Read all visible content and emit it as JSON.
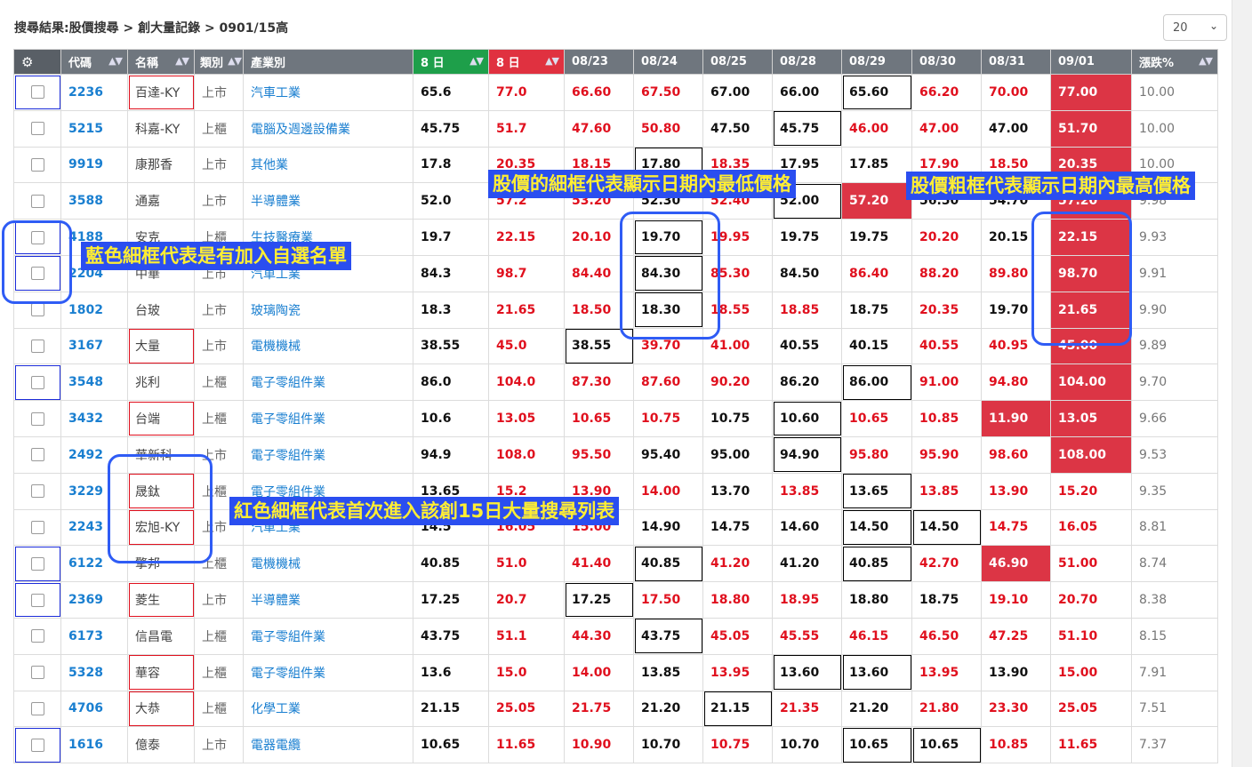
{
  "breadcrumb": "搜尋結果:股價搜尋 > 創大量記錄 > 0901/15高",
  "page_size": {
    "value": "20",
    "chevron_icon": "chevron-down-icon"
  },
  "columns": {
    "settings_icon": "gear-icon",
    "code": "代碼",
    "name": "名稱",
    "type": "類別",
    "industry": "產業別",
    "d8a": "8 日",
    "d8b": "8 日",
    "dates": [
      "08/23",
      "08/24",
      "08/25",
      "08/28",
      "08/29",
      "08/30",
      "08/31",
      "09/01"
    ],
    "pct": "漲跌%"
  },
  "colors": {
    "header": "#6f767e",
    "green_header": "#1e9f4a",
    "red_header": "#e03140",
    "highlight": "#dc3545",
    "link": "#1a7fd0",
    "callout_bg": "#2a4ef0",
    "callout_text": "#ffee33"
  },
  "rows": [
    {
      "code": "2236",
      "name": "百達-KY",
      "type": "上市",
      "industry": "汽車工業",
      "v1": "65.6",
      "v2": "77.0",
      "d": [
        "66.60",
        "67.50",
        "67.00",
        "66.00",
        "65.60",
        "66.20",
        "70.00",
        "77.00"
      ],
      "pct": "10.00"
    },
    {
      "code": "5215",
      "name": "科嘉-KY",
      "type": "上櫃",
      "industry": "電腦及週邊設備業",
      "v1": "45.75",
      "v2": "51.7",
      "d": [
        "47.60",
        "50.80",
        "47.50",
        "45.75",
        "46.00",
        "47.00",
        "47.00",
        "51.70"
      ],
      "pct": "10.00"
    },
    {
      "code": "9919",
      "name": "康那香",
      "type": "上市",
      "industry": "其他業",
      "v1": "17.8",
      "v2": "20.35",
      "d": [
        "18.15",
        "17.80",
        "18.35",
        "17.95",
        "17.85",
        "17.90",
        "18.50",
        "20.35"
      ],
      "pct": "10.00"
    },
    {
      "code": "3588",
      "name": "通嘉",
      "type": "上市",
      "industry": "半導體業",
      "v1": "52.0",
      "v2": "57.2",
      "d": [
        "53.20",
        "52.30",
        "52.40",
        "52.00",
        "57.20",
        "56.50",
        "54.70",
        "57.20"
      ],
      "pct": "9.98"
    },
    {
      "code": "4188",
      "name": "安克",
      "type": "上櫃",
      "industry": "生技醫療業",
      "v1": "19.7",
      "v2": "22.15",
      "d": [
        "20.10",
        "19.70",
        "19.95",
        "19.75",
        "19.75",
        "20.20",
        "20.15",
        "22.15"
      ],
      "pct": "9.93"
    },
    {
      "code": "2204",
      "name": "中華",
      "type": "上市",
      "industry": "汽車工業",
      "v1": "84.3",
      "v2": "98.7",
      "d": [
        "84.40",
        "84.30",
        "85.30",
        "84.50",
        "86.40",
        "88.20",
        "89.80",
        "98.70"
      ],
      "pct": "9.91"
    },
    {
      "code": "1802",
      "name": "台玻",
      "type": "上市",
      "industry": "玻璃陶瓷",
      "v1": "18.3",
      "v2": "21.65",
      "d": [
        "18.50",
        "18.30",
        "18.55",
        "18.85",
        "18.75",
        "20.35",
        "19.70",
        "21.65"
      ],
      "pct": "9.90"
    },
    {
      "code": "3167",
      "name": "大量",
      "type": "上市",
      "industry": "電機機械",
      "v1": "38.55",
      "v2": "45.0",
      "d": [
        "38.55",
        "39.70",
        "41.00",
        "40.55",
        "40.15",
        "40.55",
        "40.95",
        "45.00"
      ],
      "pct": "9.89"
    },
    {
      "code": "3548",
      "name": "兆利",
      "type": "上櫃",
      "industry": "電子零組件業",
      "v1": "86.0",
      "v2": "104.0",
      "d": [
        "87.30",
        "87.60",
        "90.20",
        "86.20",
        "86.00",
        "91.00",
        "94.80",
        "104.00"
      ],
      "pct": "9.70"
    },
    {
      "code": "3432",
      "name": "台端",
      "type": "上櫃",
      "industry": "電子零組件業",
      "v1": "10.6",
      "v2": "13.05",
      "d": [
        "10.65",
        "10.75",
        "10.75",
        "10.60",
        "10.65",
        "10.85",
        "11.90",
        "13.05"
      ],
      "pct": "9.66"
    },
    {
      "code": "2492",
      "name": "華新科",
      "type": "上市",
      "industry": "電子零組件業",
      "v1": "94.9",
      "v2": "108.0",
      "d": [
        "95.50",
        "95.40",
        "95.00",
        "94.90",
        "95.80",
        "95.90",
        "98.60",
        "108.00"
      ],
      "pct": "9.53"
    },
    {
      "code": "3229",
      "name": "晟鈦",
      "type": "上櫃",
      "industry": "電子零組件業",
      "v1": "13.65",
      "v2": "15.2",
      "d": [
        "13.90",
        "14.00",
        "13.70",
        "13.85",
        "13.65",
        "13.85",
        "13.90",
        "15.20"
      ],
      "pct": "9.35"
    },
    {
      "code": "2243",
      "name": "宏旭-KY",
      "type": "上市",
      "industry": "汽車工業",
      "v1": "14.5",
      "v2": "16.05",
      "d": [
        "15.00",
        "14.90",
        "14.75",
        "14.60",
        "14.50",
        "14.50",
        "14.75",
        "16.05"
      ],
      "pct": "8.81"
    },
    {
      "code": "6122",
      "name": "擎邦",
      "type": "上櫃",
      "industry": "電機機械",
      "v1": "40.85",
      "v2": "51.0",
      "d": [
        "41.40",
        "40.85",
        "41.20",
        "41.20",
        "40.85",
        "42.70",
        "46.90",
        "51.00"
      ],
      "pct": "8.74"
    },
    {
      "code": "2369",
      "name": "菱生",
      "type": "上市",
      "industry": "半導體業",
      "v1": "17.25",
      "v2": "20.7",
      "d": [
        "17.25",
        "17.50",
        "18.80",
        "18.95",
        "18.80",
        "18.75",
        "19.10",
        "20.70"
      ],
      "pct": "8.38"
    },
    {
      "code": "6173",
      "name": "信昌電",
      "type": "上櫃",
      "industry": "電子零組件業",
      "v1": "43.75",
      "v2": "51.1",
      "d": [
        "44.30",
        "43.75",
        "45.05",
        "45.55",
        "46.15",
        "46.50",
        "47.25",
        "51.10"
      ],
      "pct": "8.15"
    },
    {
      "code": "5328",
      "name": "華容",
      "type": "上櫃",
      "industry": "電子零組件業",
      "v1": "13.6",
      "v2": "15.0",
      "d": [
        "14.00",
        "13.85",
        "13.95",
        "13.60",
        "13.60",
        "13.95",
        "13.90",
        "15.00"
      ],
      "pct": "7.91"
    },
    {
      "code": "4706",
      "name": "大恭",
      "type": "上櫃",
      "industry": "化學工業",
      "v1": "21.15",
      "v2": "25.05",
      "d": [
        "21.75",
        "21.20",
        "21.15",
        "21.35",
        "21.20",
        "21.80",
        "23.30",
        "25.05"
      ],
      "pct": "7.51"
    },
    {
      "code": "1616",
      "name": "億泰",
      "type": "上市",
      "industry": "電器電纜",
      "v1": "10.65",
      "v2": "11.65",
      "d": [
        "10.90",
        "10.70",
        "10.75",
        "10.70",
        "10.65",
        "10.65",
        "10.85",
        "11.65"
      ],
      "pct": "7.37"
    }
  ],
  "callouts": {
    "thin_box": "股價的細框代表顯示日期內最低價格",
    "thick_box": "股價粗框代表顯示日期內最高價格",
    "blue_box": "藍色細框代表是有加入自選名單",
    "red_box": "紅色細框代表首次進入該創15日大量搜尋列表"
  }
}
